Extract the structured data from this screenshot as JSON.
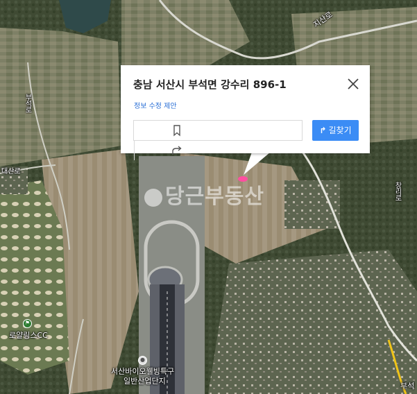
{
  "popup": {
    "address": "충남 서산시 부석면 강수리 896-1",
    "suggest_edit": "정보 수정 제안",
    "route_label": "길찾기",
    "save_icon": "bookmark-icon",
    "share_icon": "share-icon",
    "close_icon": "close-icon",
    "route_icon": "route-icon"
  },
  "map": {
    "watermark": "당근부동산",
    "labels": {
      "top_right_road": "지산로",
      "left_vertical": "부석로",
      "left_small": "대산로",
      "right_vertical": "창리로",
      "golf": "로얄링스CC",
      "complex_line1": "서산바이오웰빙특구",
      "complex_line2": "일반산업단지",
      "bottom_right": "부석"
    },
    "marker_color": "#ff4fa0",
    "poi_icons": [
      "golf-course-icon",
      "industrial-complex-icon"
    ]
  }
}
